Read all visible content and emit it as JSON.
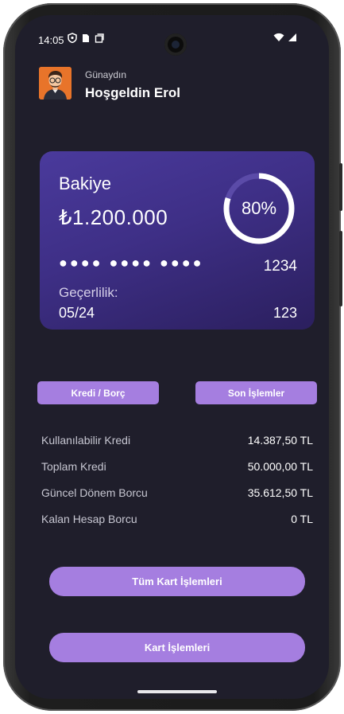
{
  "status_bar": {
    "time": "14:05"
  },
  "header": {
    "greeting_small": "Günaydın",
    "greeting_title": "Hoşgeldin Erol"
  },
  "card": {
    "label": "Bakiye",
    "balance": "₺1.200.000",
    "progress_text": "80%",
    "progress_fraction": 0.8,
    "masked_number": "●●●● ●●●● ●●●●",
    "last4": "1234",
    "valid_label": "Geçerlilik:",
    "valid_date": "05/24",
    "cvv": "123"
  },
  "tabs": {
    "credit_debt": "Kredi / Borç",
    "recent_transactions": "Son İşlemler"
  },
  "info_rows": [
    {
      "label": "Kullanılabilir Kredi",
      "value": "14.387,50 TL"
    },
    {
      "label": "Toplam Kredi",
      "value": "50.000,00 TL"
    },
    {
      "label": "Güncel Dönem Borcu",
      "value": "35.612,50 TL"
    },
    {
      "label": "Kalan Hesap Borcu",
      "value": "0 TL"
    }
  ],
  "actions": {
    "all_card_transactions": "Tüm Kart İşlemleri",
    "card_transactions": "Kart İşlemleri"
  },
  "colors": {
    "background": "#1f1e2b",
    "accent": "#a57ee0",
    "card_gradient_start": "#4a3a9c",
    "card_gradient_end": "#2b1f5e"
  }
}
